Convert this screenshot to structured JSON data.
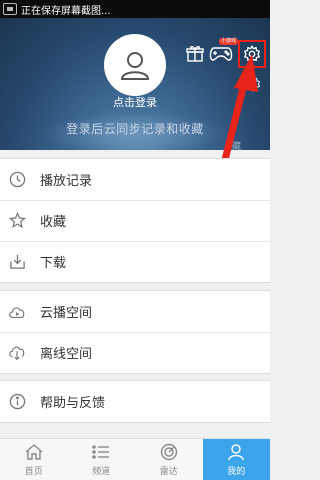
{
  "status_bar": {
    "text": "正在保存屏幕截图..."
  },
  "header": {
    "login_label": "点击登录",
    "sync_label": "登录后云同步记录和收藏",
    "badge": "小游戏",
    "blurred_text": "藏"
  },
  "menu": {
    "group1": [
      {
        "label": "播放记录",
        "icon": "clock-icon"
      },
      {
        "label": "收藏",
        "icon": "star-icon"
      },
      {
        "label": "下载",
        "icon": "download-icon"
      }
    ],
    "group2": [
      {
        "label": "云播空间",
        "icon": "cloud-play-icon"
      },
      {
        "label": "离线空间",
        "icon": "cloud-download-icon"
      }
    ],
    "group3": [
      {
        "label": "帮助与反馈",
        "icon": "info-icon"
      }
    ]
  },
  "tabs": [
    {
      "label": "首页",
      "icon": "home-icon",
      "active": false
    },
    {
      "label": "频道",
      "icon": "list-icon",
      "active": false
    },
    {
      "label": "雷达",
      "icon": "radar-icon",
      "active": false
    },
    {
      "label": "我的",
      "icon": "person-icon",
      "active": true
    }
  ],
  "colors": {
    "accent": "#3ba4ea",
    "highlight_red": "#e8231a",
    "header_dark": "#27496d"
  }
}
